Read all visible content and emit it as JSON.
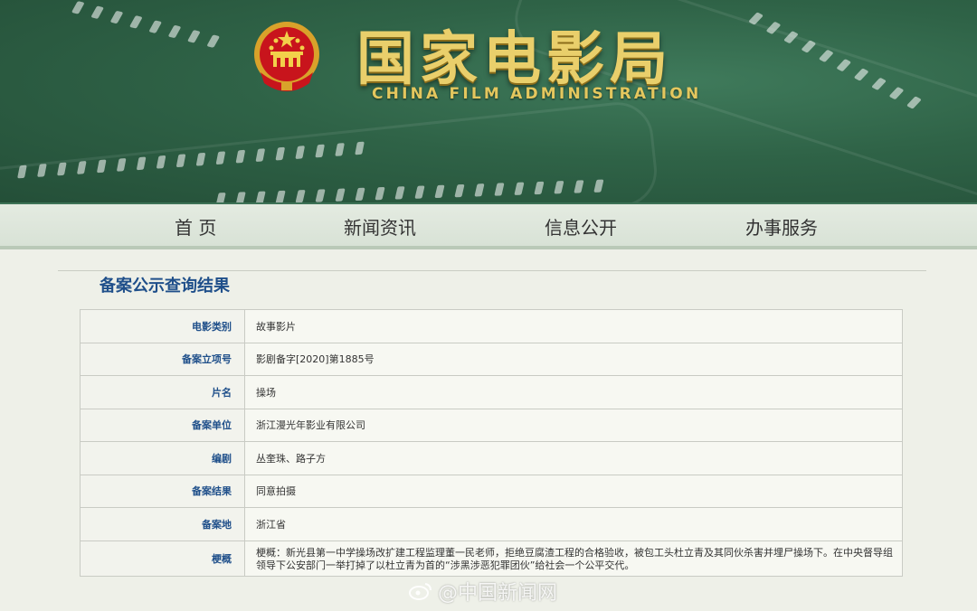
{
  "header": {
    "title_cn": "国家电影局",
    "title_en": "CHINA FILM ADMINISTRATION",
    "emblem_icon": "national-emblem-icon",
    "colors": {
      "banner_green": "#2f6347",
      "title_gold": "#e9cf6b"
    }
  },
  "nav": {
    "items": [
      {
        "label": "首 页"
      },
      {
        "label": "新闻资讯"
      },
      {
        "label": "信息公开"
      },
      {
        "label": "办事服务"
      }
    ]
  },
  "section": {
    "title": "备案公示查询结果"
  },
  "record": {
    "rows": [
      {
        "label": "电影类别",
        "value": "故事影片"
      },
      {
        "label": "备案立项号",
        "value": "影剧备字[2020]第1885号"
      },
      {
        "label": "片名",
        "value": "操场"
      },
      {
        "label": "备案单位",
        "value": "浙江漫光年影业有限公司"
      },
      {
        "label": "编剧",
        "value": "丛奎珠、路子方"
      },
      {
        "label": "备案结果",
        "value": "同意拍摄"
      },
      {
        "label": "备案地",
        "value": "浙江省"
      },
      {
        "label": "梗概",
        "value": "梗概：新光县第一中学操场改扩建工程监理董一民老师，拒绝豆腐渣工程的合格验收，被包工头杜立青及其同伙杀害并埋尸操场下。在中央督导组领导下公安部门一举打掉了以杜立青为首的“涉黑涉恶犯罪团伙”给社会一个公平交代。"
      }
    ]
  },
  "watermark": {
    "text": "@中国新闻网",
    "icon": "weibo-icon"
  }
}
